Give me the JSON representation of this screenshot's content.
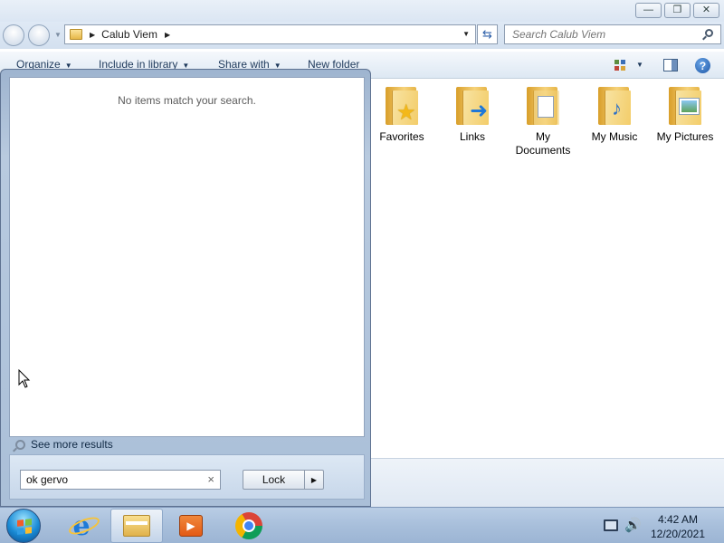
{
  "window": {
    "caption": {
      "minimize": "—",
      "maximize": "❐",
      "close": "✕"
    }
  },
  "address": {
    "path": "Calub Viem",
    "search_placeholder": "Search Calub Viem"
  },
  "toolbar": {
    "organize": "Organize",
    "include_library": "Include in library",
    "share_with": "Share with",
    "new_folder": "New folder",
    "help_glyph": "?"
  },
  "folders": [
    {
      "label": "Favorites",
      "icon": "folder-favorites-icon"
    },
    {
      "label": "Links",
      "icon": "folder-links-icon"
    },
    {
      "label": "My Documents",
      "icon": "folder-documents-icon"
    },
    {
      "label": "My Music",
      "icon": "folder-music-icon"
    },
    {
      "label": "My Pictures",
      "icon": "folder-pictures-icon"
    }
  ],
  "start_menu": {
    "no_items": "No items match your search.",
    "see_more": "See more results",
    "search_value": "ok gervo",
    "clear_glyph": "×",
    "lock_label": "Lock",
    "lock_arrow": "▶"
  },
  "taskbar": {
    "apps": [
      "start-orb",
      "internet-explorer-icon",
      "windows-explorer-icon",
      "media-player-icon",
      "chrome-icon"
    ],
    "time": "4:42 AM",
    "date": "12/20/2021"
  }
}
